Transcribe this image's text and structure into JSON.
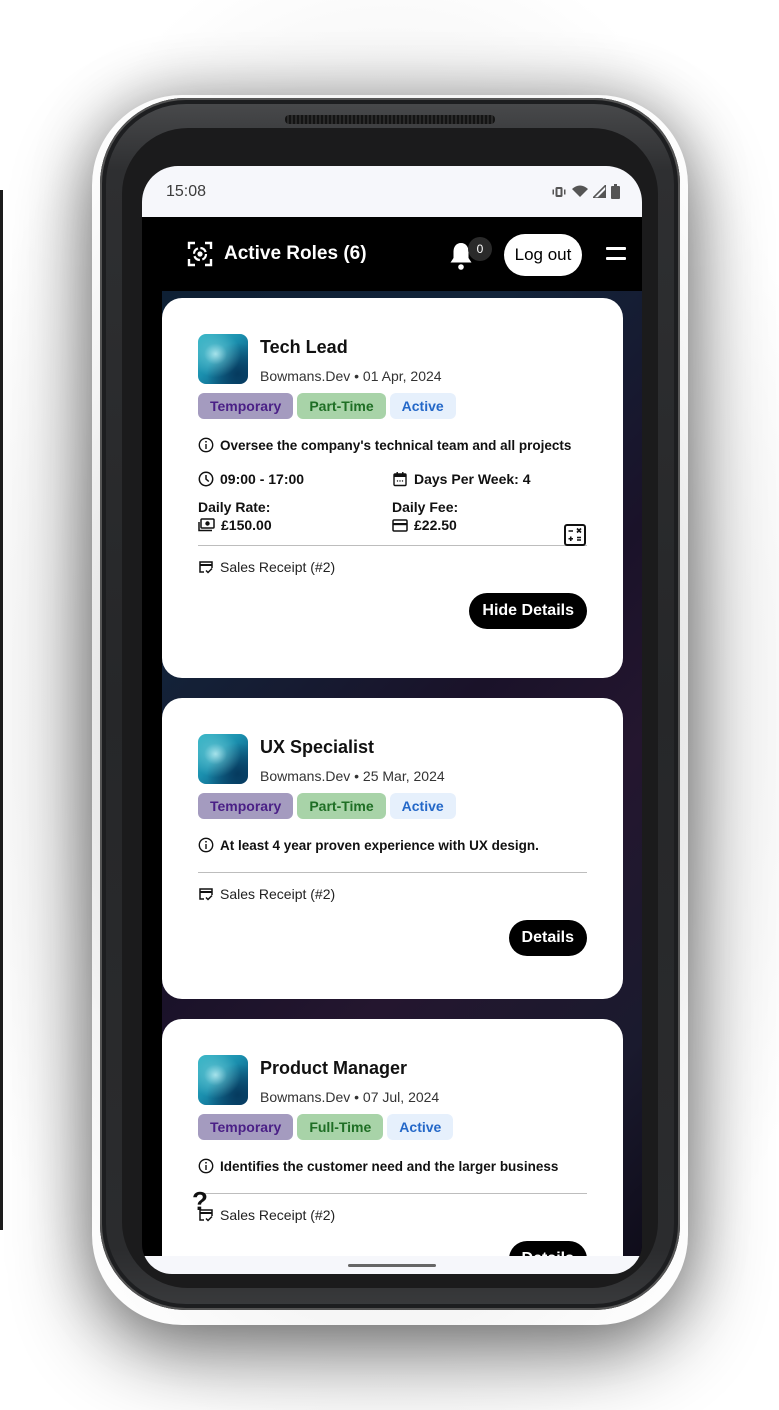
{
  "status_bar": {
    "time": "15:08",
    "icons": [
      "vibrate-icon",
      "wifi-icon",
      "signal-icon",
      "battery-icon"
    ]
  },
  "header": {
    "brand_icon": "focus-scan-icon",
    "title": "Active Roles (6)",
    "notification_count": "0",
    "logout_label": "Log out",
    "menu_icon": "hamburger-menu-icon"
  },
  "colors": {
    "tag_temporary_bg": "#a49bbf",
    "tag_temporary_fg": "#4a1f86",
    "tag_time_bg": "#a8d3a8",
    "tag_time_fg": "#1e6e24",
    "tag_active_bg": "#e6f0fc",
    "tag_active_fg": "#2468c8"
  },
  "cards": [
    {
      "title": "Tech Lead",
      "subtitle": "Bowmans.Dev • 01 Apr, 2024",
      "tags": [
        "Temporary",
        "Part-Time",
        "Active"
      ],
      "description": "Oversee the company's technical team and all projects",
      "hours": "09:00 - 17:00",
      "days_per_week": "Days Per Week: 4",
      "daily_rate_label": "Daily Rate:",
      "daily_rate_value": "£150.00",
      "daily_fee_label": "Daily Fee:",
      "daily_fee_value": "£22.50",
      "receipt": "Sales Receipt (#2)",
      "button_label": "Hide Details"
    },
    {
      "title": "UX Specialist",
      "subtitle": "Bowmans.Dev • 25 Mar, 2024",
      "tags": [
        "Temporary",
        "Part-Time",
        "Active"
      ],
      "description": "At least 4 year proven experience with UX design.",
      "receipt": "Sales Receipt (#2)",
      "button_label": "Details"
    },
    {
      "title": "Product Manager",
      "subtitle": "Bowmans.Dev • 07 Jul, 2024",
      "tags": [
        "Temporary",
        "Full-Time",
        "Active"
      ],
      "description": "Identifies the customer need and the larger business",
      "receipt": "Sales Receipt (#2)",
      "button_label": "Details"
    }
  ],
  "help_fab": "?"
}
